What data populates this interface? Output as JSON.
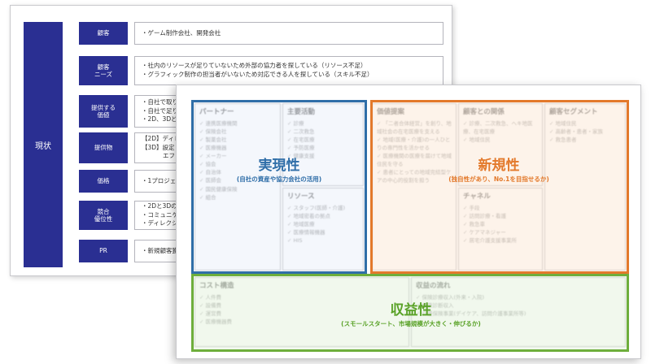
{
  "current_state": {
    "label": "現状",
    "rows": [
      {
        "label": "顧客",
        "lines": [
          "・ゲーム制作会社、開発会社"
        ]
      },
      {
        "label": "顧客\nニーズ",
        "lines": [
          "・社内のリソースが足りていないため外部の協力者を探している（リソース不足）",
          "・グラフィック制作の担当者がいないため対応できる人を探している（スキル不足）"
        ]
      },
      {
        "label": "提供する\n価値",
        "lines": [
          "・自社で取り",
          "・自社で足り",
          "・2D、3Dど"
        ]
      },
      {
        "label": "提供物",
        "lines": [
          "【2D】ディレ",
          "【3D】設定・",
          "エフェ"
        ]
      },
      {
        "label": "価格",
        "lines": [
          "・1プロジェ"
        ]
      },
      {
        "label": "競合\n優位性",
        "lines": [
          "・2Dと3Dの",
          "・コミュニケ",
          "・ディレクシ"
        ]
      },
      {
        "label": "PR",
        "lines": [
          "・新規顧客獲"
        ]
      }
    ]
  },
  "canvas": {
    "cells": {
      "partners": {
        "title": "パートナー",
        "items": [
          "連携医療機関",
          "保険会社",
          "製薬会社",
          "医療機器",
          "メーカー",
          "協会",
          "自治体",
          "医師会",
          "国民健康保険",
          "組合"
        ]
      },
      "key_activities": {
        "title": "主要活動",
        "items": [
          "診療",
          "二次救急",
          "在宅医療",
          "予防医療",
          "健康支援"
        ]
      },
      "resources": {
        "title": "リソース",
        "items": [
          "スタッフ(医師・介護)",
          "地域密着の拠点",
          "地域医療",
          "医療情報機器",
          "HIS"
        ]
      },
      "value_proposition": {
        "title": "価値提案",
        "items": [
          "「二者合体経営」を創り、地域社会の在宅医療を支える",
          "地域(医療・介護)の一人ひとりの専門性を活かせる",
          "医療機関の医療を届けて地域住民を守る",
          "患者にとっての地域完結型ケアの中心的役割を担う"
        ]
      },
      "customer_relationships": {
        "title": "顧客との関係",
        "items": [
          "診療、二次救急、ヘキ地医療、在宅医療",
          "地域住民"
        ]
      },
      "channels": {
        "title": "チャネル",
        "items": [
          "手段",
          "訪問診療・看護",
          "救急車",
          "ケアマネジャー",
          "居宅介護支援事業所"
        ]
      },
      "customer_segments": {
        "title": "顧客セグメント",
        "items": [
          "地域住民",
          "高齢者・患者・家族",
          "救急患者"
        ]
      },
      "cost_structure": {
        "title": "コスト構造",
        "items": [
          "人件費",
          "設備費",
          "運営費",
          "医療機器費"
        ]
      },
      "revenue_streams": {
        "title": "収益の流れ",
        "items": [
          "保険診療収入(外来・入院)",
          "健康診断収入",
          "介護保険事業(デイケア、訪問介護事業所等)"
        ]
      }
    },
    "highlights": {
      "feasibility": {
        "main": "実現性",
        "sub": "(自社の資産や協力会社の活用)"
      },
      "novelty": {
        "main": "新規性",
        "sub": "(独自性があり、No.1を目指せるか)"
      },
      "profitability": {
        "main": "収益性",
        "sub": "(スモールスタート、市場規模が大きく・伸びるか)"
      }
    },
    "colors": {
      "feasibility": "#2f6ea8",
      "novelty": "#e3792b",
      "profitability": "#6eae3c",
      "status_fill": "#2a2f92"
    }
  }
}
